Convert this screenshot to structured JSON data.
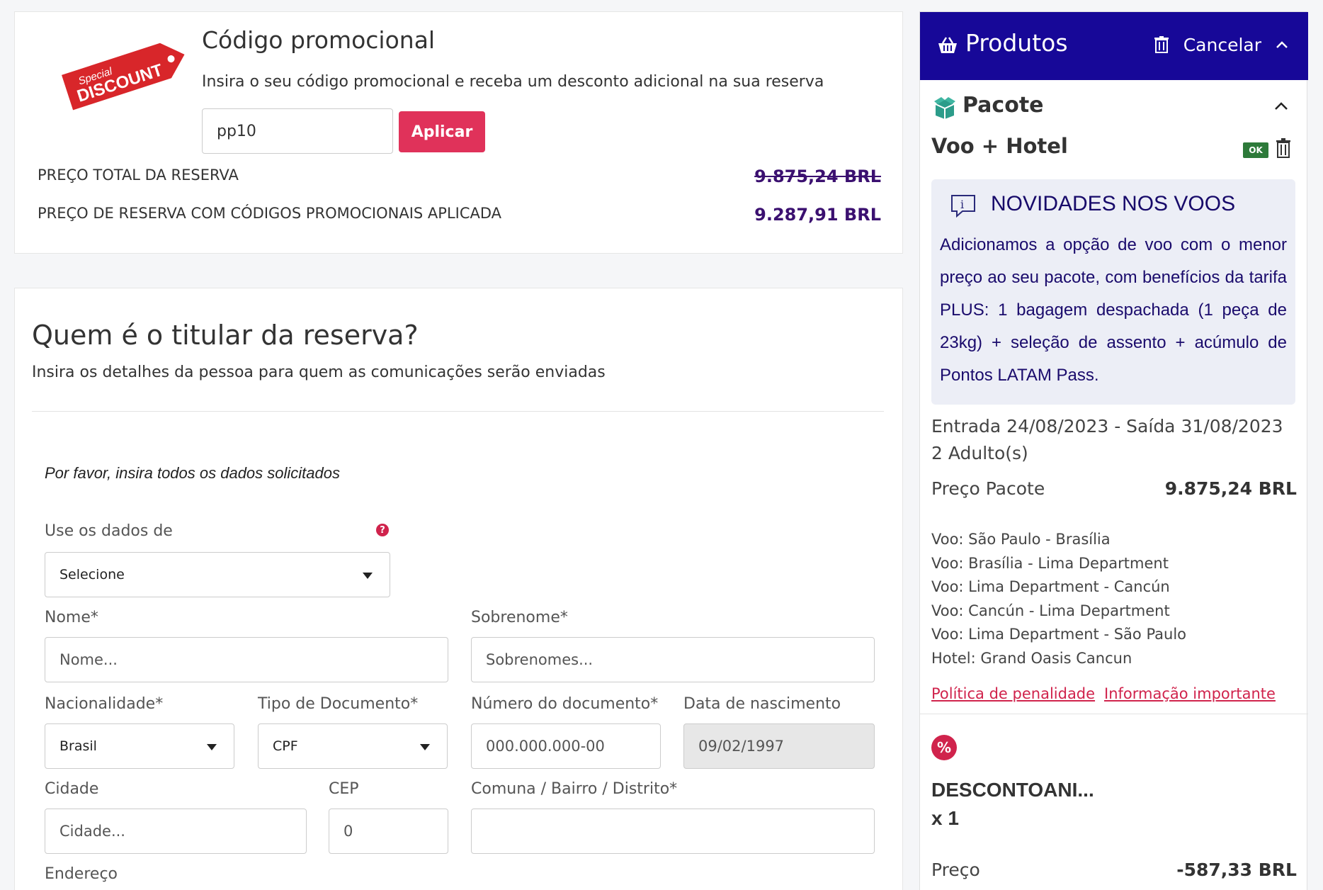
{
  "promo": {
    "badge_top": "Special",
    "badge_main": "DISCOUNT",
    "title": "Código promocional",
    "subtitle": "Insira o seu código promocional e receba um desconto adicional na sua reserva",
    "code_value": "pp10",
    "apply_label": "Aplicar",
    "total_label": "PREÇO TOTAL DA RESERVA",
    "total_value": "9.875,24 BRL",
    "discounted_label": "PREÇO DE RESERVA COM CÓDIGOS PROMOCIONAIS APLICADA",
    "discounted_value": "9.287,91 BRL"
  },
  "holder": {
    "title": "Quem é o titular da reserva?",
    "subtitle": "Insira os detalhes da pessoa para quem as comunicações serão enviadas",
    "instruction": "Por favor, insira todos os dados solicitados",
    "use_data_label": "Use os dados de",
    "use_data_value": "Selecione",
    "name_label": "Nome*",
    "name_placeholder": "Nome...",
    "surname_label": "Sobrenome*",
    "surname_placeholder": "Sobrenomes...",
    "nationality_label": "Nacionalidade*",
    "nationality_value": "Brasil",
    "doc_type_label": "Tipo de Documento*",
    "doc_type_value": "CPF",
    "doc_number_label": "Número do documento*",
    "doc_number_placeholder": "000.000.000-00",
    "birth_label": "Data de nascimento",
    "birth_value": "09/02/1997",
    "city_label": "Cidade",
    "city_placeholder": "Cidade...",
    "cep_label": "CEP",
    "cep_value": "0",
    "district_label": "Comuna / Bairro / Distrito*",
    "address_label": "Endereço"
  },
  "side": {
    "header_title": "Produtos",
    "cancel_label": "Cancelar",
    "package_title": "Pacote",
    "package_name": "Voo + Hotel",
    "ok_badge": "OK",
    "news_title": "NOVIDADES NOS VOOS",
    "news_body": "Adicionamos a opção de voo com o menor preço ao seu pacote, com benefícios da tarifa PLUS: 1 bagagem despachada (1 peça de 23kg) + seleção de assento + acúmulo de Pontos LATAM Pass.",
    "dates": "Entrada 24/08/2023 - Saída 31/08/2023",
    "adults": "2 Adulto(s)",
    "package_price_label": "Preço Pacote",
    "package_price_value": "9.875,24 BRL",
    "legs": [
      "Voo: São Paulo - Brasília",
      "Voo: Brasília - Lima Department",
      "Voo: Lima Department - Cancún",
      "Voo: Cancún - Lima Department",
      "Voo: Lima Department - São Paulo",
      "Hotel: Grand Oasis Cancun"
    ],
    "penalty_link": "Política de penalidade",
    "info_link": "Informação importante",
    "discount_icon": "%",
    "discount_name": "DESCONTOANI...",
    "discount_qty": "x 1",
    "discount_price_label": "Preço",
    "discount_price_value": "-587,33 BRL"
  },
  "colors": {
    "header_bg": "#170898",
    "accent_red": "#e0325a",
    "price_purple": "#3b1070",
    "ok_green": "#2d7a3a"
  }
}
